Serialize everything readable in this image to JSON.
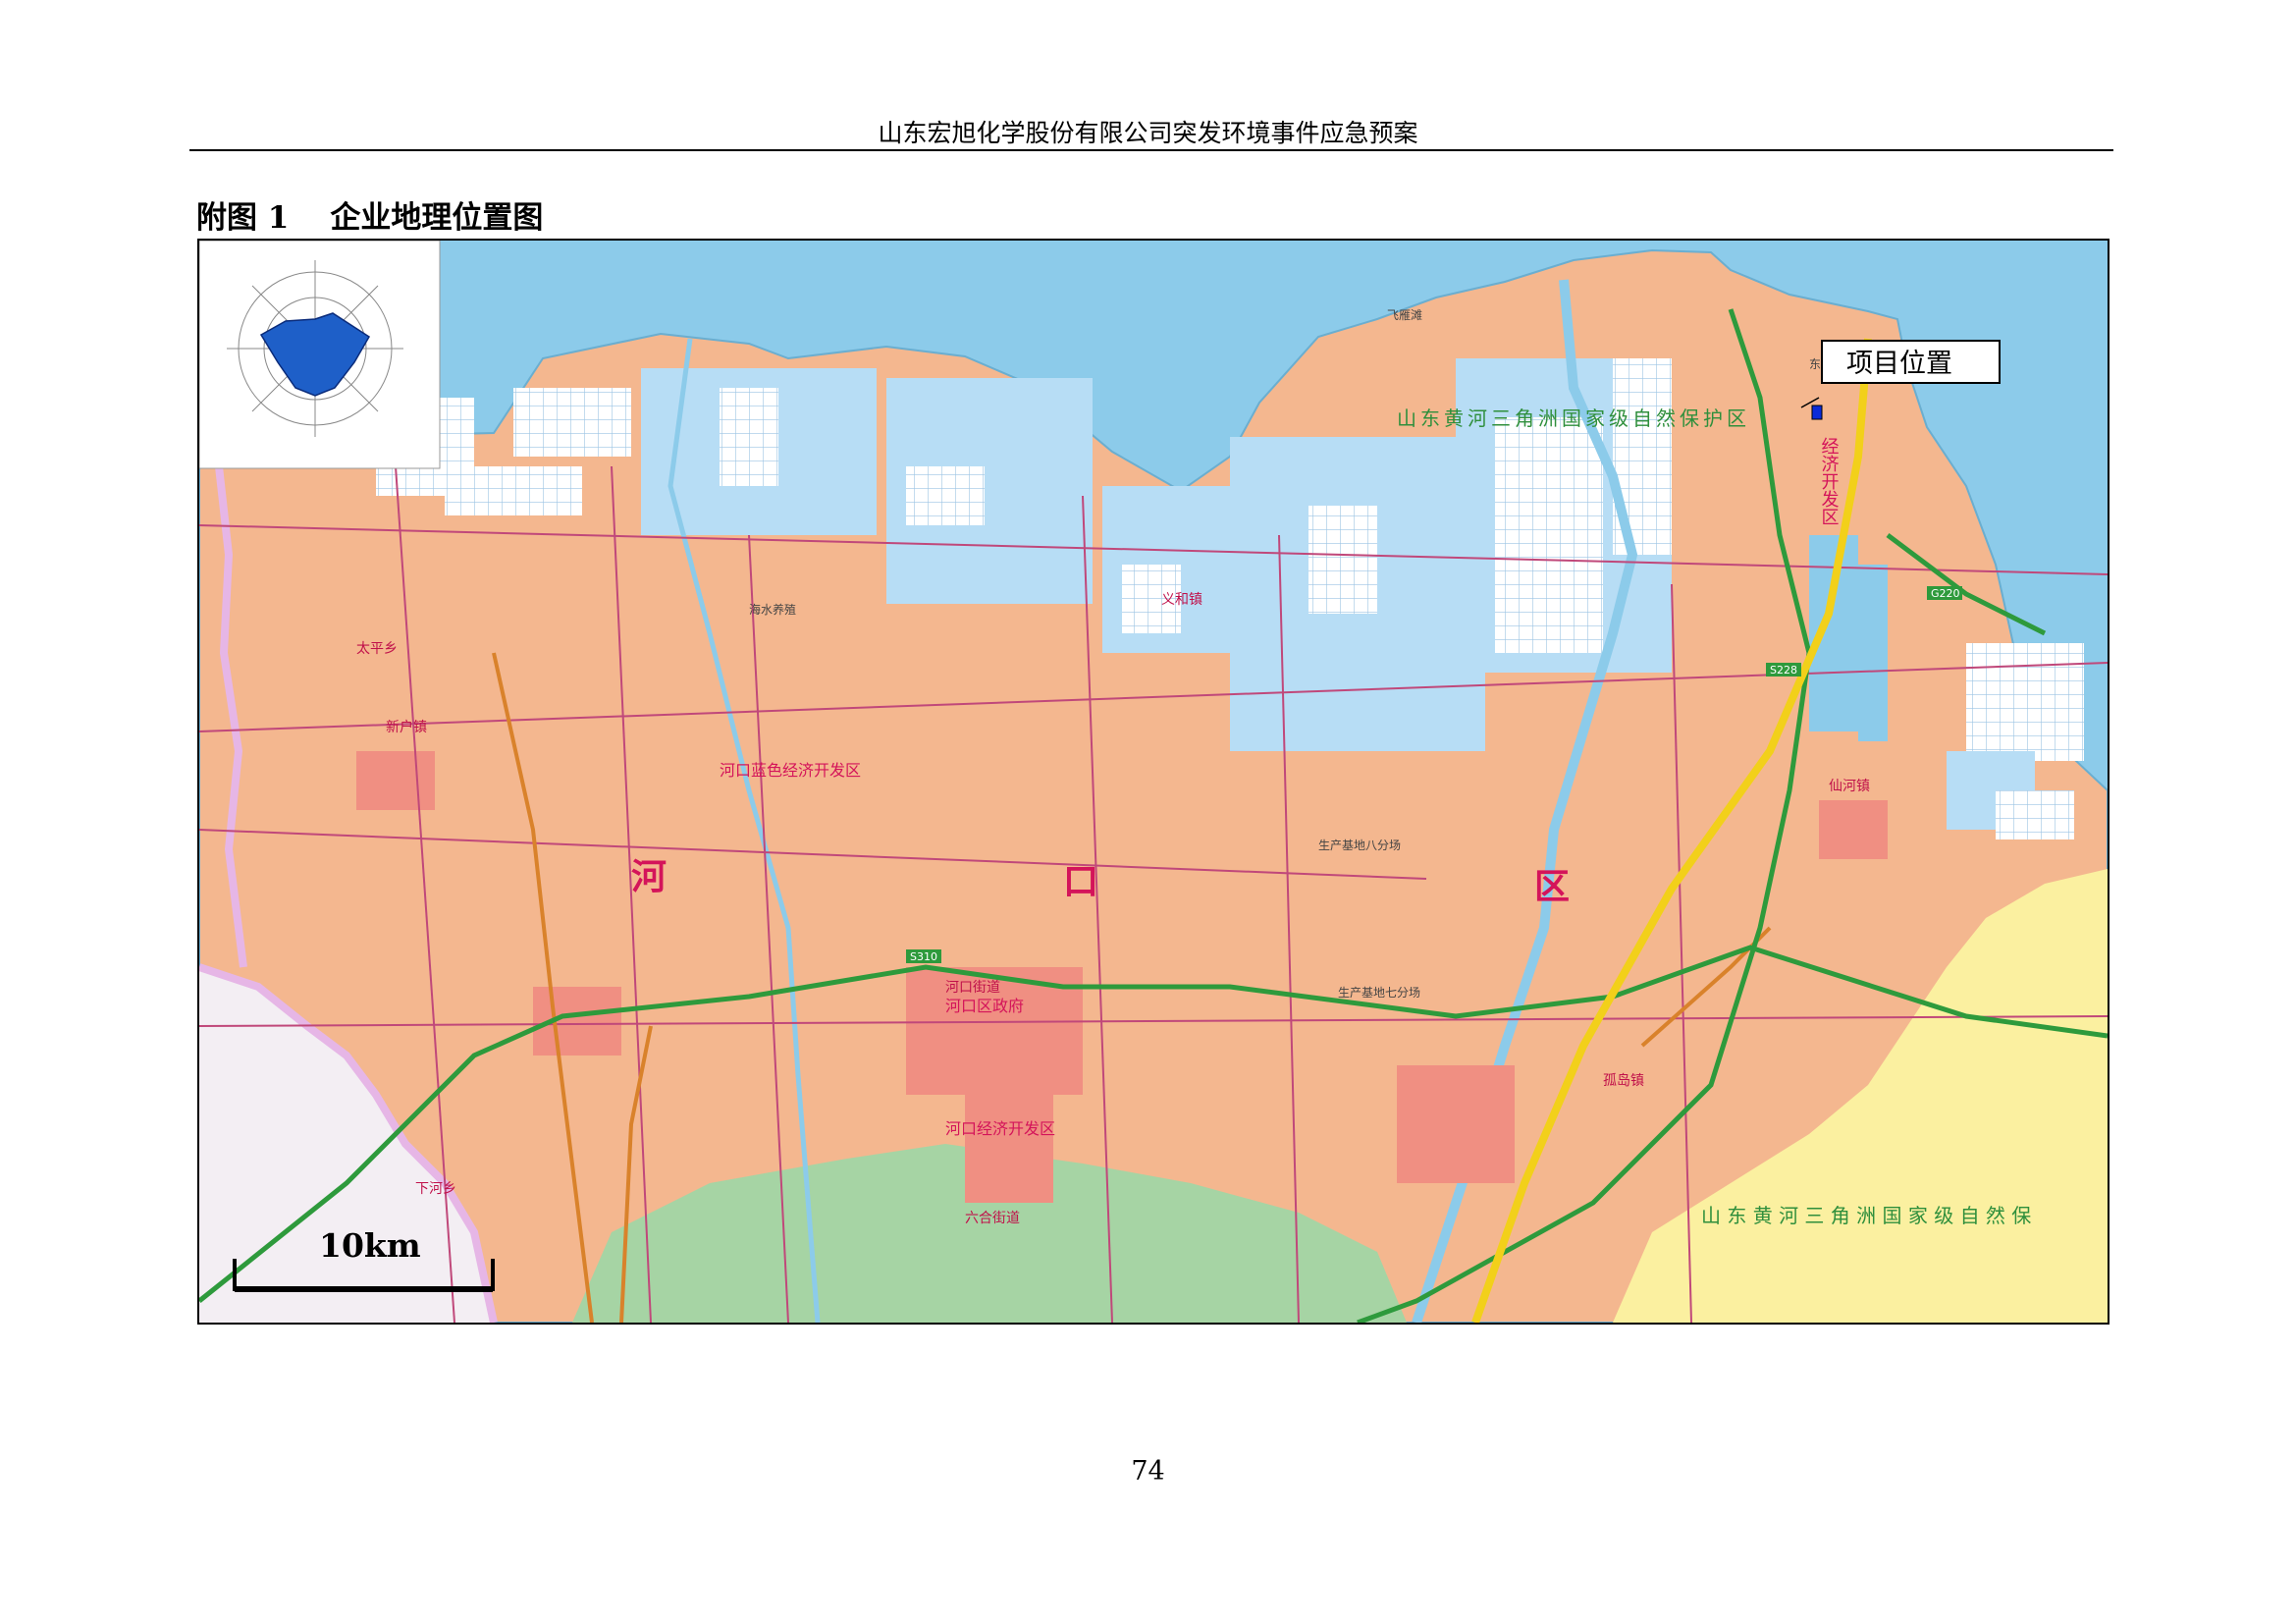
{
  "document": {
    "header_title": "山东宏旭化学股份有限公司突发环境事件应急预案",
    "figure_number": "附图 1",
    "figure_title": "企业地理位置图",
    "page_number": "74"
  },
  "map": {
    "project_label": "项目位置",
    "scale_bar_label": "10km",
    "district_chars": [
      "河",
      "口",
      "区"
    ],
    "reserve_label_north": "山东黄河三角洲国家级自然保护区",
    "reserve_label_south": "山 东 黄 河 三 角 洲 国 家 级 自 然 保",
    "econ_zone_vertical": "经济开发区",
    "blue_econ_zone": "河口蓝色经济开发区",
    "econ_dev_zone": "河口经济开发区",
    "district_gov": "河口区政府",
    "town_labels": [
      "新户镇",
      "孤岛镇",
      "仙河镇",
      "六合街道",
      "义和镇",
      "河口街道",
      "下河乡",
      "太平乡"
    ],
    "place_labels": [
      "海水养殖",
      "生产基地八分场",
      "生产基地七分场",
      "东营港",
      "飞雁滩"
    ],
    "road_labels": [
      "S310",
      "S228",
      "G220"
    ],
    "colors": {
      "sea": "#8ccbea",
      "ponds": "#b7ddf5",
      "land": "#f4b78f",
      "reserve_south": "#fbf0a0",
      "forest": "#a6d4a4",
      "county_boundary": "#e6b6e6",
      "province_road": "#2e9a3c",
      "expressway": "#f2d01a",
      "project_marker": "#0a2bd8",
      "district_text": "#d4145a"
    },
    "icons": [
      "wind-rose-icon",
      "project-marker-icon",
      "scale-bar-icon"
    ]
  }
}
